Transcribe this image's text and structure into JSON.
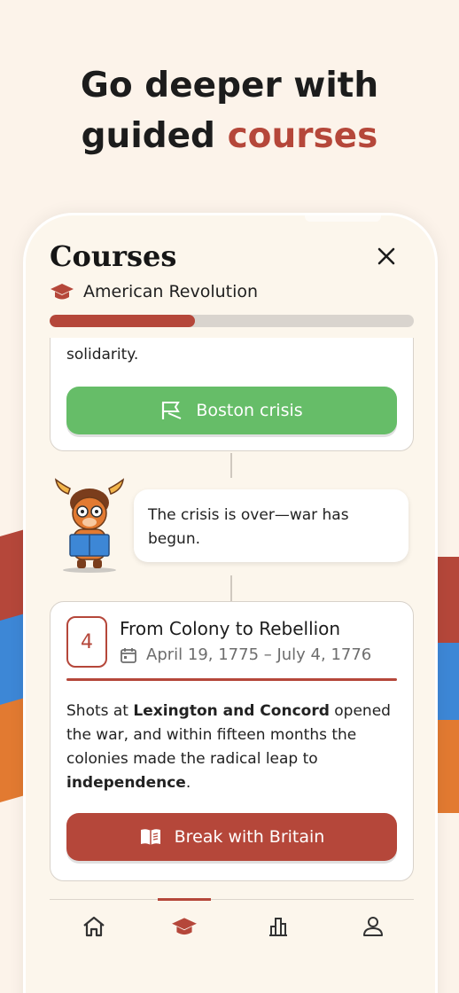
{
  "headline": {
    "line1": "Go deeper with",
    "line2_prefix": "guided ",
    "line2_accent": "courses"
  },
  "colors": {
    "accent": "#b5473a",
    "green": "#66bd68",
    "blue": "#3d87d6",
    "orange": "#e27a31",
    "background": "#fcf3ea"
  },
  "screen": {
    "title": "Courses",
    "close_icon": "close-icon",
    "course_name": "American Revolution",
    "course_icon": "graduation-cap-icon",
    "progress_percent": 40
  },
  "previous_card": {
    "text_tail": "solidarity.",
    "button_label": "Boston crisis",
    "button_icon": "flag-icon"
  },
  "mascot_message": "The crisis is over—war has begun.",
  "unit": {
    "number": "4",
    "title": "From Colony to Rebellion",
    "date_icon": "calendar-icon",
    "dates": "April 19, 1775 – July 4, 1776",
    "desc_1": "Shots at ",
    "desc_bold_1": "Lexington and Concord",
    "desc_2": " opened the war, and within fifteen months the colonies made the radical leap to ",
    "desc_bold_2": "independence",
    "desc_3": ".",
    "button_label": "Break with Britain",
    "button_icon": "book-icon"
  },
  "nav": {
    "items": [
      {
        "icon": "home-icon"
      },
      {
        "icon": "graduation-cap-icon",
        "active": true
      },
      {
        "icon": "stats-icon"
      },
      {
        "icon": "profile-icon"
      }
    ]
  }
}
